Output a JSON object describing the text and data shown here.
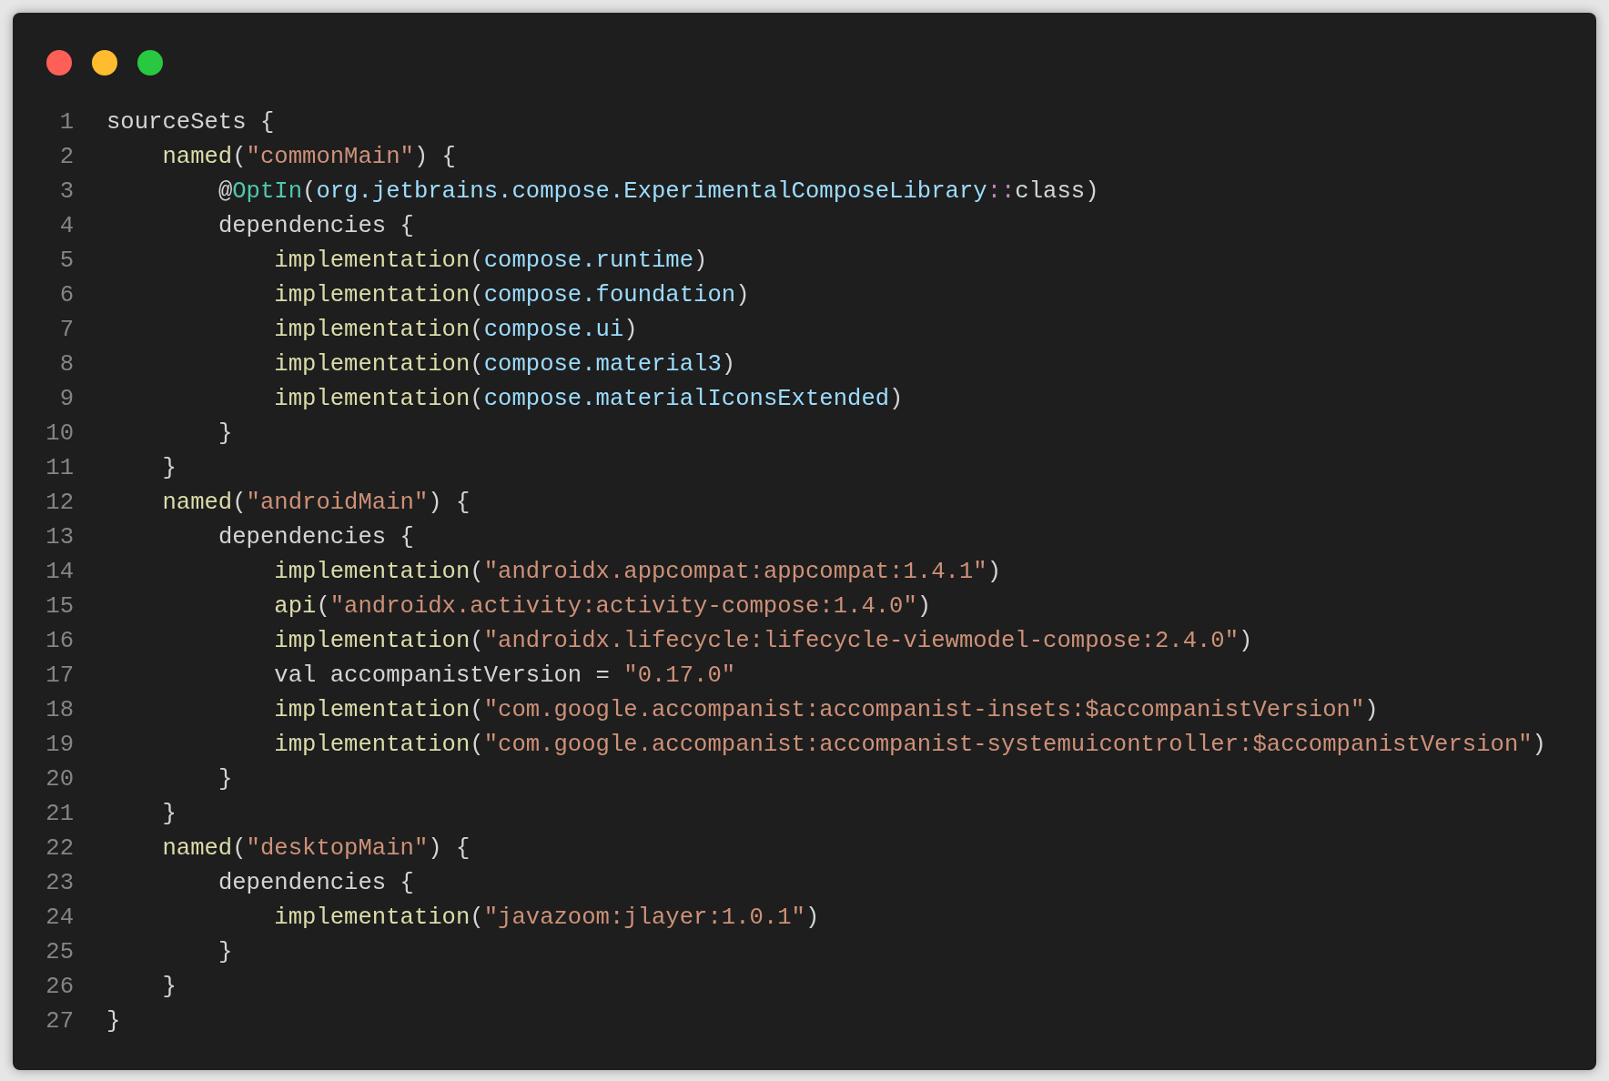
{
  "window": {
    "controls": [
      {
        "kind": "close",
        "color": "#ff5f57"
      },
      {
        "kind": "minimize",
        "color": "#febc2e"
      },
      {
        "kind": "zoom",
        "color": "#28c840"
      }
    ]
  },
  "code": {
    "lines": [
      {
        "number": "1",
        "tokens": [
          {
            "kind": "plain",
            "text": "sourceSets {"
          }
        ]
      },
      {
        "number": "2",
        "tokens": [
          {
            "kind": "fn",
            "text": "    named"
          },
          {
            "kind": "plain",
            "text": "("
          },
          {
            "kind": "str",
            "text": "\"commonMain\""
          },
          {
            "kind": "plain",
            "text": ") {"
          }
        ]
      },
      {
        "number": "3",
        "tokens": [
          {
            "kind": "plain",
            "text": "        @"
          },
          {
            "kind": "type",
            "text": "OptIn"
          },
          {
            "kind": "plain",
            "text": "("
          },
          {
            "kind": "prop",
            "text": "org.jetbrains.compose.ExperimentalComposeLibrary"
          },
          {
            "kind": "op",
            "text": "::"
          },
          {
            "kind": "plain",
            "text": "class)"
          }
        ]
      },
      {
        "number": "4",
        "tokens": [
          {
            "kind": "plain",
            "text": "        dependencies {"
          }
        ]
      },
      {
        "number": "5",
        "tokens": [
          {
            "kind": "fn",
            "text": "            implementation"
          },
          {
            "kind": "plain",
            "text": "("
          },
          {
            "kind": "prop",
            "text": "compose.runtime"
          },
          {
            "kind": "plain",
            "text": ")"
          }
        ]
      },
      {
        "number": "6",
        "tokens": [
          {
            "kind": "fn",
            "text": "            implementation"
          },
          {
            "kind": "plain",
            "text": "("
          },
          {
            "kind": "prop",
            "text": "compose.foundation"
          },
          {
            "kind": "plain",
            "text": ")"
          }
        ]
      },
      {
        "number": "7",
        "tokens": [
          {
            "kind": "fn",
            "text": "            implementation"
          },
          {
            "kind": "plain",
            "text": "("
          },
          {
            "kind": "prop",
            "text": "compose.ui"
          },
          {
            "kind": "plain",
            "text": ")"
          }
        ]
      },
      {
        "number": "8",
        "tokens": [
          {
            "kind": "fn",
            "text": "            implementation"
          },
          {
            "kind": "plain",
            "text": "("
          },
          {
            "kind": "prop",
            "text": "compose.material3"
          },
          {
            "kind": "plain",
            "text": ")"
          }
        ]
      },
      {
        "number": "9",
        "tokens": [
          {
            "kind": "fn",
            "text": "            implementation"
          },
          {
            "kind": "plain",
            "text": "("
          },
          {
            "kind": "prop",
            "text": "compose.materialIconsExtended"
          },
          {
            "kind": "plain",
            "text": ")"
          }
        ]
      },
      {
        "number": "10",
        "tokens": [
          {
            "kind": "plain",
            "text": "        }"
          }
        ]
      },
      {
        "number": "11",
        "tokens": [
          {
            "kind": "plain",
            "text": "    }"
          }
        ]
      },
      {
        "number": "12",
        "tokens": [
          {
            "kind": "fn",
            "text": "    named"
          },
          {
            "kind": "plain",
            "text": "("
          },
          {
            "kind": "str",
            "text": "\"androidMain\""
          },
          {
            "kind": "plain",
            "text": ") {"
          }
        ]
      },
      {
        "number": "13",
        "tokens": [
          {
            "kind": "plain",
            "text": "        dependencies {"
          }
        ]
      },
      {
        "number": "14",
        "tokens": [
          {
            "kind": "fn",
            "text": "            implementation"
          },
          {
            "kind": "plain",
            "text": "("
          },
          {
            "kind": "str",
            "text": "\"androidx.appcompat:appcompat:1.4.1\""
          },
          {
            "kind": "plain",
            "text": ")"
          }
        ]
      },
      {
        "number": "15",
        "tokens": [
          {
            "kind": "fn",
            "text": "            api"
          },
          {
            "kind": "plain",
            "text": "("
          },
          {
            "kind": "str",
            "text": "\"androidx.activity:activity-compose:1.4.0\""
          },
          {
            "kind": "plain",
            "text": ")"
          }
        ]
      },
      {
        "number": "16",
        "tokens": [
          {
            "kind": "fn",
            "text": "            implementation"
          },
          {
            "kind": "plain",
            "text": "("
          },
          {
            "kind": "str",
            "text": "\"androidx.lifecycle:lifecycle-viewmodel-compose:2.4.0\""
          },
          {
            "kind": "plain",
            "text": ")"
          }
        ]
      },
      {
        "number": "17",
        "tokens": [
          {
            "kind": "plain",
            "text": "            val accompanistVersion = "
          },
          {
            "kind": "str",
            "text": "\"0.17.0\""
          }
        ]
      },
      {
        "number": "18",
        "tokens": [
          {
            "kind": "fn",
            "text": "            implementation"
          },
          {
            "kind": "plain",
            "text": "("
          },
          {
            "kind": "str",
            "text": "\"com.google.accompanist:accompanist-insets:$accompanistVersion\""
          },
          {
            "kind": "plain",
            "text": ")"
          }
        ]
      },
      {
        "number": "19",
        "tokens": [
          {
            "kind": "fn",
            "text": "            implementation"
          },
          {
            "kind": "plain",
            "text": "("
          },
          {
            "kind": "str",
            "text": "\"com.google.accompanist:accompanist-systemuicontroller:$accompanistVersion\""
          },
          {
            "kind": "plain",
            "text": ")"
          }
        ]
      },
      {
        "number": "20",
        "tokens": [
          {
            "kind": "plain",
            "text": "        }"
          }
        ]
      },
      {
        "number": "21",
        "tokens": [
          {
            "kind": "plain",
            "text": "    }"
          }
        ]
      },
      {
        "number": "22",
        "tokens": [
          {
            "kind": "fn",
            "text": "    named"
          },
          {
            "kind": "plain",
            "text": "("
          },
          {
            "kind": "str",
            "text": "\"desktopMain\""
          },
          {
            "kind": "plain",
            "text": ") {"
          }
        ]
      },
      {
        "number": "23",
        "tokens": [
          {
            "kind": "plain",
            "text": "        dependencies {"
          }
        ]
      },
      {
        "number": "24",
        "tokens": [
          {
            "kind": "fn",
            "text": "            implementation"
          },
          {
            "kind": "plain",
            "text": "("
          },
          {
            "kind": "str",
            "text": "\"javazoom:jlayer:1.0.1\""
          },
          {
            "kind": "plain",
            "text": ")"
          }
        ]
      },
      {
        "number": "25",
        "tokens": [
          {
            "kind": "plain",
            "text": "        }"
          }
        ]
      },
      {
        "number": "26",
        "tokens": [
          {
            "kind": "plain",
            "text": "    }"
          }
        ]
      },
      {
        "number": "27",
        "tokens": [
          {
            "kind": "plain",
            "text": "}"
          }
        ]
      }
    ]
  }
}
